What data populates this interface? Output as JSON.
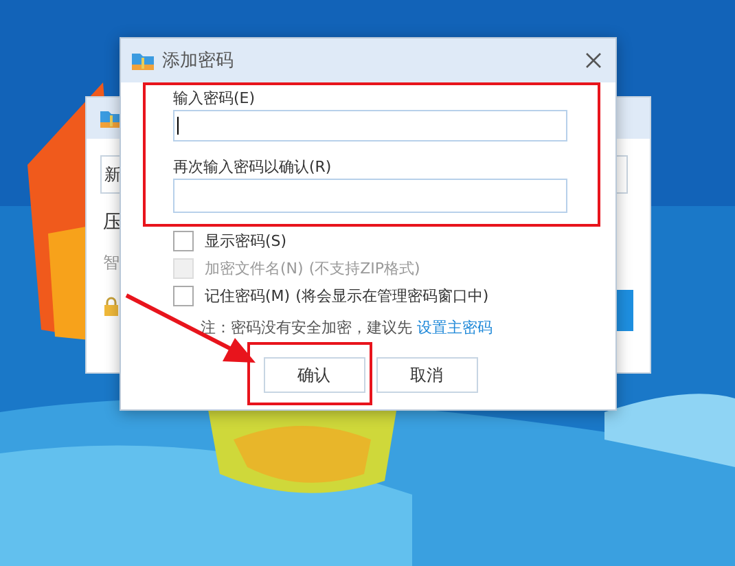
{
  "background_window": {
    "texts": [
      "新",
      "压",
      "智"
    ]
  },
  "dialog": {
    "title": "添加密码",
    "fields": [
      {
        "label": "输入密码(E)",
        "focused": true
      },
      {
        "label": "再次输入密码以确认(R)",
        "focused": false
      }
    ],
    "options": [
      {
        "label": "显示密码(S)",
        "checked": false,
        "disabled": false
      },
      {
        "label": "加密文件名(N)",
        "hint": "(不支持ZIP格式)",
        "checked": false,
        "disabled": true
      },
      {
        "label": "记住密码(M)",
        "hint": "(将会显示在管理密码窗口中)",
        "checked": false,
        "disabled": false
      }
    ],
    "note": {
      "text": "注：密码没有安全加密，建议先",
      "link": "设置主密码"
    },
    "buttons": [
      "确认",
      "取消"
    ]
  }
}
